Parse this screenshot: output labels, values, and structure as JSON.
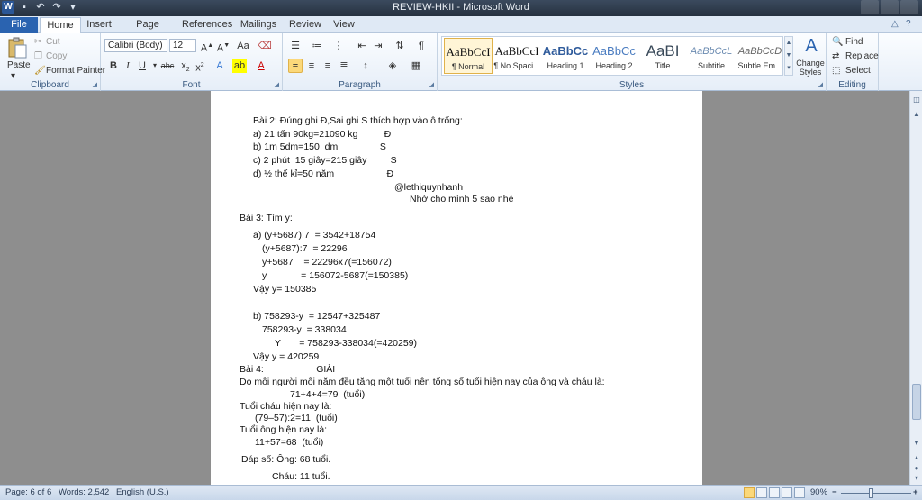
{
  "window": {
    "title": "REVIEW-HKII - Microsoft Word"
  },
  "tabs": [
    {
      "label": "File"
    },
    {
      "label": "Home"
    },
    {
      "label": "Insert"
    },
    {
      "label": "Page Layout"
    },
    {
      "label": "References"
    },
    {
      "label": "Mailings"
    },
    {
      "label": "Review"
    },
    {
      "label": "View"
    }
  ],
  "ribbon": {
    "clipboard": {
      "label": "Clipboard",
      "paste": "Paste",
      "cut": "Cut",
      "copy": "Copy",
      "format_painter": "Format Painter"
    },
    "font": {
      "label": "Font",
      "name": "Calibri (Body)",
      "size": "12"
    },
    "paragraph": {
      "label": "Paragraph"
    },
    "styles": {
      "label": "Styles",
      "items": [
        {
          "sample": "AaBbCcI",
          "name": "¶ Normal"
        },
        {
          "sample": "AaBbCcI",
          "name": "¶ No Spaci..."
        },
        {
          "sample": "AaBbCc",
          "name": "Heading 1"
        },
        {
          "sample": "AaBbCc",
          "name": "Heading 2"
        },
        {
          "sample": "AaBI",
          "name": "Title"
        },
        {
          "sample": "AaBbCcL",
          "name": "Subtitle"
        },
        {
          "sample": "AaBbCcD",
          "name": "Subtle Em..."
        }
      ],
      "change_styles": "Change Styles"
    },
    "editing": {
      "label": "Editing",
      "find": "Find",
      "replace": "Replace",
      "select": "Select"
    }
  },
  "document": {
    "lines": [
      "Bài 2: Đúng ghi Đ,Sai ghi S thích hợp vào ô trống:",
      "a) 21 tấn 90kg=21090 kg          Đ",
      "b) 1m 5dm=150  dm                S",
      "c) 2 phút  15 giây=215 giây         S",
      "d) ½ thế kỉ=50 năm                    Đ",
      "@lethiquynhanh",
      "Nhớ cho mình 5 sao nhé",
      "Bài 3: Tìm y:",
      "a) (y+5687):7  = 3542+18754",
      "(y+5687):7  = 22296",
      "y+5687    = 22296x7(=156072)",
      "y             = 156072-5687(=150385)",
      "Vậy y= 150385",
      "b) 758293-y  = 12547+325487",
      "758293-y  = 338034",
      "Y       = 758293-338034(=420259)",
      "Vậy y = 420259",
      "Bài 4:                    GIẢI",
      "Do mỗi người mỗi năm đều tăng một tuổi nên tổng số tuổi hiện nay của ông và cháu là:",
      "71+4+4=79  (tuổi)",
      "Tuổi cháu hiện nay là:",
      "(79–57):2=11  (tuổi)",
      "Tuổi ông hiện nay là:",
      "11+57=68  (tuổi)",
      "Đáp số: Ông: 68 tuổi.",
      "Cháu: 11 tuổi."
    ]
  },
  "status": {
    "page": "Page: 6 of 6",
    "words": "Words: 2,542",
    "language": "English (U.S.)",
    "zoom": "90%",
    "zoom_minus": "−",
    "zoom_plus": "+"
  }
}
